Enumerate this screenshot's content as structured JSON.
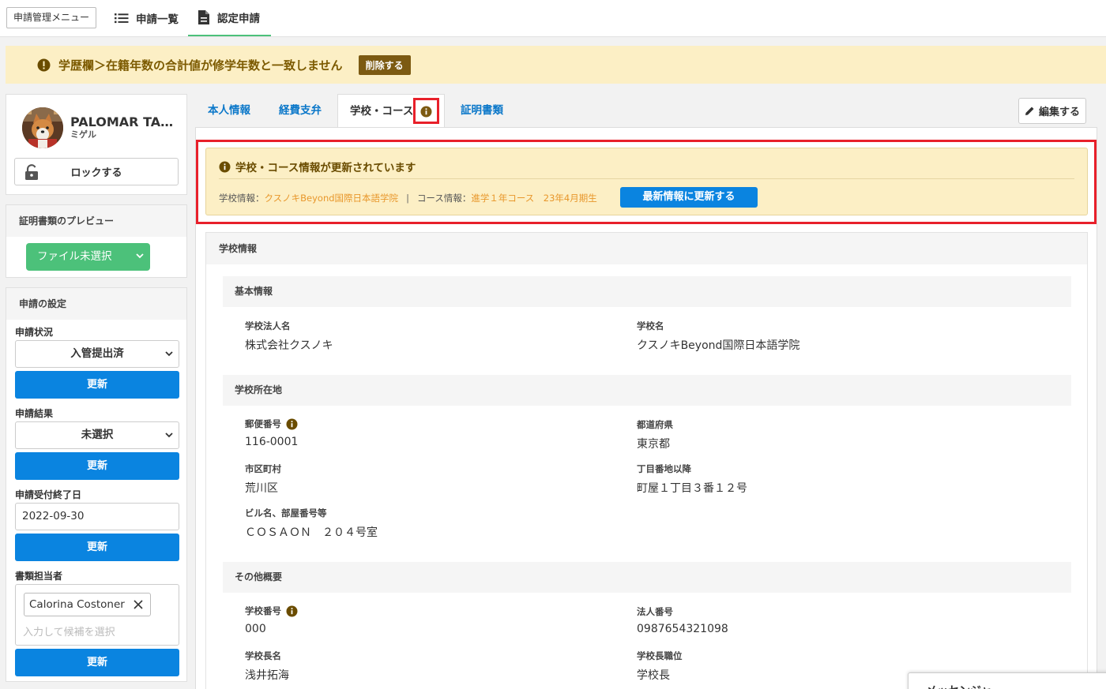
{
  "topnav": {
    "menu_label": "申請管理メニュー",
    "list_label": "申請一覧",
    "apply_label": "認定申請"
  },
  "alert": {
    "text": "学歴欄＞在籍年数の合計値が修学年数と一致しません",
    "delete_label": "削除する"
  },
  "profile": {
    "name": "PALOMAR TA…",
    "sub": "ミゲル",
    "lock_label": "ロックする"
  },
  "preview": {
    "title": "証明書類のプレビュー",
    "file_select": "ファイル未選択"
  },
  "settings": {
    "title": "申請の設定",
    "status_label": "申請状況",
    "status_value": "入管提出済",
    "result_label": "申請結果",
    "result_value": "未選択",
    "deadline_label": "申請受付終了日",
    "deadline_value": "2022-09-30",
    "owner_label": "書類担当者",
    "owner_tag": "Calorina Costoner",
    "owner_placeholder": "入力して候補を選択",
    "update_label": "更新"
  },
  "tabs": {
    "personal": "本人情報",
    "expense": "経費支弁",
    "school": "学校・コース",
    "documents": "証明書類",
    "edit_label": "編集する"
  },
  "notice": {
    "title": "学校・コース情報が更新されています",
    "school_label": "学校情報：",
    "school_value": "クスノキBeyond国際日本語学院",
    "separator": "|",
    "course_label": "コース情報：",
    "course_value": "進学１年コース　23年4月期生",
    "update_label": "最新情報に更新する"
  },
  "school": {
    "title": "学校情報",
    "basic_head": "基本情報",
    "corp_name_label": "学校法人名",
    "corp_name_value": "株式会社クスノキ",
    "school_name_label": "学校名",
    "school_name_value": "クスノキBeyond国際日本語学院",
    "address_head": "学校所在地",
    "zip_label": "郵便番号",
    "zip_value": "116-0001",
    "pref_label": "都道府県",
    "pref_value": "東京都",
    "city_label": "市区町村",
    "city_value": "荒川区",
    "street_label": "丁目番地以降",
    "street_value": "町屋１丁目３番１２号",
    "building_label": "ビル名、部屋番号等",
    "building_value": "ＣＯＳＡＯＮ　２０４号室",
    "other_head": "その他概要",
    "school_no_label": "学校番号",
    "school_no_value": "000",
    "corp_no_label": "法人番号",
    "corp_no_value": "0987654321098",
    "principal_label": "学校長名",
    "principal_value": "浅井拓海",
    "principal_title_label": "学校長職位",
    "principal_title_value": "学校長"
  },
  "messenger": {
    "label": "メッセンジャー"
  },
  "colors": {
    "accent_green": "#4cc17a",
    "primary_blue": "#0a84e0",
    "warning_bg": "#fcefc5",
    "warning_text": "#7c5a00",
    "highlight_red": "#e8202a"
  }
}
